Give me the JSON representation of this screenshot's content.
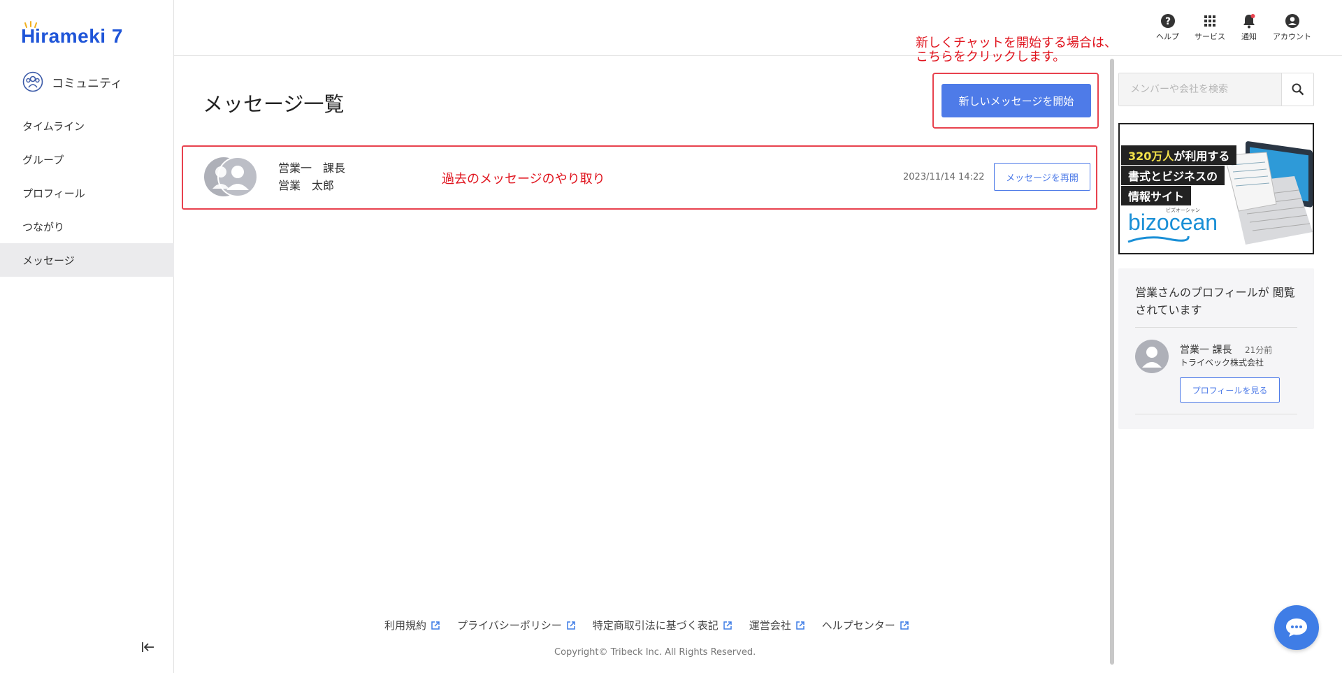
{
  "app": {
    "logo_text": "irameki 7",
    "community_label": "コミュニティ"
  },
  "sidebar": {
    "items": [
      {
        "label": "タイムライン"
      },
      {
        "label": "グループ"
      },
      {
        "label": "プロフィール"
      },
      {
        "label": "つながり"
      },
      {
        "label": "メッセージ",
        "active": true
      }
    ]
  },
  "topbar": {
    "help": "ヘルプ",
    "services": "サービス",
    "notifications": "通知",
    "account": "アカウント"
  },
  "main": {
    "title": "メッセージ一覧",
    "new_message_button": "新しいメッセージを開始",
    "annotation_new_line1": "新しくチャットを開始する場合は、",
    "annotation_new_line2": "こちらをクリックします。",
    "annotation_history": "過去のメッセージのやり取り",
    "messages": [
      {
        "name1": "営業一　課長",
        "name2": "営業　太郎",
        "date": "2023/11/14 14:22",
        "resume_button": "メッセージを再開"
      }
    ]
  },
  "footer": {
    "links": [
      "利用規約",
      "プライバシーポリシー",
      "特定商取引法に基づく表記",
      "運営会社",
      "ヘルプセンター"
    ],
    "copyright": "Copyright© Tribeck Inc. All Rights Reserved."
  },
  "right": {
    "search_placeholder": "メンバーや会社を検索",
    "banner": {
      "line1_highlight": "320万人",
      "line1_rest": "が利用する",
      "line2": "書式とビジネスの",
      "line3": "情報サイト",
      "logo": "bizocean",
      "logo_sub": "ビズオーシャン"
    },
    "viewers": {
      "title": "営業さんのプロフィールが 閲覧されています",
      "name": "営業一 課長",
      "time": "21分前",
      "company": "トライベック株式会社",
      "profile_button": "プロフィールを見る"
    }
  },
  "colors": {
    "accent": "#4e7be8",
    "annotation": "#e0141e",
    "logo": "#1f55d8"
  }
}
